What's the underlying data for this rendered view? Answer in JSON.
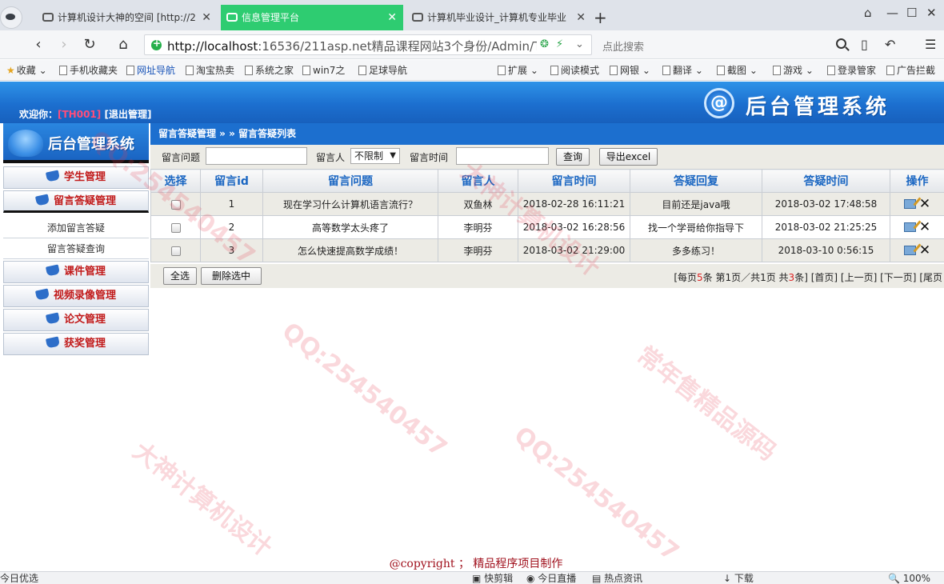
{
  "browser": {
    "tabs": [
      {
        "title": "计算机设计大神的空间 [http://2"
      },
      {
        "title": "信息管理平台"
      },
      {
        "title": "计算机毕业设计_计算机专业毕业"
      }
    ],
    "url_host": "http://localhost",
    "url_rest": ":16536/211asp.net精品课程网站3个身份/Admin/T",
    "search_placeholder": "点此搜索",
    "bookmarks": [
      "收藏",
      "手机收藏夹",
      "网址导航",
      "淘宝热卖",
      "系统之家",
      "win7之",
      "足球导航"
    ],
    "toolbar_right": [
      "扩展",
      "阅读模式",
      "网银",
      "翻译",
      "截图",
      "游戏",
      "登录管家",
      "广告拦截"
    ],
    "status": {
      "left": "今日优选",
      "items": [
        "快剪辑",
        "今日直播",
        "热点资讯",
        "下载"
      ],
      "zoom": "100%"
    }
  },
  "header": {
    "welcome_prefix": "欢迎你：",
    "username": "[TH001]",
    "logout": "[退出管理]",
    "brand_icon_glyph": "@",
    "brand_title": "后台管理系统"
  },
  "sidebar": {
    "logo_text": "后台管理系统",
    "menus": [
      {
        "label": "学生管理"
      },
      {
        "label": "留言答疑管理"
      },
      {
        "label": "课件管理"
      },
      {
        "label": "视频录像管理"
      },
      {
        "label": "论文管理"
      },
      {
        "label": "获奖管理"
      }
    ],
    "submenu": [
      "添加留言答疑",
      "留言答疑查询"
    ]
  },
  "breadcrumb": "留言答疑管理 » » 留言答疑列表",
  "filter": {
    "question_label": "留言问题",
    "question_value": "",
    "person_label": "留言人",
    "person_value": "不限制",
    "time_label": "留言时间",
    "time_value": "",
    "query_button": "查询",
    "export_button": "导出excel"
  },
  "table": {
    "columns": [
      "选择",
      "留言id",
      "留言问题",
      "留言人",
      "留言时间",
      "答疑回复",
      "答疑时间",
      "操作"
    ],
    "rows": [
      {
        "id": "1",
        "question": "现在学习什么计算机语言流行？",
        "person": "双鱼林",
        "time": "2018-02-28 16:11:21",
        "reply": "目前还是java哦",
        "reply_time": "2018-03-02 17:48:58"
      },
      {
        "id": "2",
        "question": "高等数学太头疼了",
        "person": "李明芬",
        "time": "2018-03-02 16:28:56",
        "reply": "找一个学哥给你指导下",
        "reply_time": "2018-03-02 21:25:25"
      },
      {
        "id": "3",
        "question": "怎么快速提高数学成绩！",
        "person": "李明芬",
        "time": "2018-03-02 21:29:00",
        "reply": "多多练习！",
        "reply_time": "2018-03-10 0:56:15"
      }
    ]
  },
  "actions": {
    "select_all": "全选",
    "delete_selected": "删除选中"
  },
  "pager": {
    "p1": "[每页",
    "per_page": "5",
    "p2": "条 第1页／共1页 共",
    "total": "3",
    "p3": "条]",
    "first": "[首页]",
    "prev": "[上一页]",
    "next": "[下一页]",
    "last": "[尾页"
  },
  "copyright": "@copyright ； 精品程序项目制作",
  "watermark": [
    "QQ:254540457",
    "大神计算机设计",
    "常年售精品源码"
  ]
}
